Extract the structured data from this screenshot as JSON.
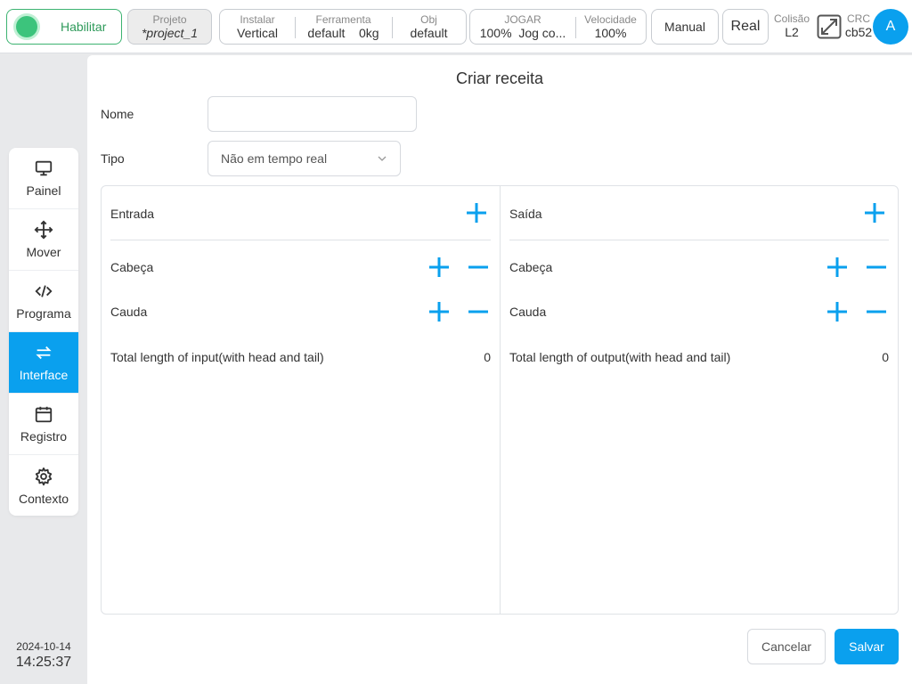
{
  "colors": {
    "accent": "#0aa0ee",
    "enable_green": "#3cc47c"
  },
  "topbar": {
    "enable_label": "Habilitar",
    "project": {
      "caption": "Projeto",
      "value": "*project_1"
    },
    "install": {
      "caption": "Instalar",
      "value": "Vertical"
    },
    "tool": {
      "caption": "Ferramenta",
      "value_name": "default",
      "value_weight": "0kg"
    },
    "obj": {
      "caption": "Obj",
      "value": "default"
    },
    "jog": {
      "caption": "JOGAR",
      "value_percent": "100%",
      "value_mode": "Jog co..."
    },
    "speed": {
      "caption": "Velocidade",
      "value": "100%"
    },
    "manual_label": "Manual",
    "real_label": "Real",
    "collision": {
      "caption": "Colisão",
      "value": "L2"
    },
    "crc": {
      "caption": "CRC",
      "value": "cb52"
    },
    "expand_icon": "expand-icon",
    "avatar_letter": "A"
  },
  "sidebar": {
    "items": [
      {
        "label": "Painel",
        "icon": "monitor-icon"
      },
      {
        "label": "Mover",
        "icon": "move-arrows-icon"
      },
      {
        "label": "Programa",
        "icon": "code-icon"
      },
      {
        "label": "Interface",
        "icon": "swap-icon",
        "active": true
      },
      {
        "label": "Registro",
        "icon": "calendar-icon"
      },
      {
        "label": "Contexto",
        "icon": "gear-icon"
      }
    ],
    "date": "2024-10-14",
    "time": "14:25:37"
  },
  "form": {
    "title": "Criar receita",
    "name_label": "Nome",
    "name_value": "",
    "type_label": "Tipo",
    "type_value": "Não em tempo real"
  },
  "input_panel": {
    "title": "Entrada",
    "head_label": "Cabeça",
    "tail_label": "Cauda",
    "total_label": "Total length of input(with head and tail)",
    "total_value": "0"
  },
  "output_panel": {
    "title": "Saída",
    "head_label": "Cabeça",
    "tail_label": "Cauda",
    "total_label": "Total length of output(with head and tail)",
    "total_value": "0"
  },
  "actions": {
    "cancel_label": "Cancelar",
    "save_label": "Salvar"
  }
}
